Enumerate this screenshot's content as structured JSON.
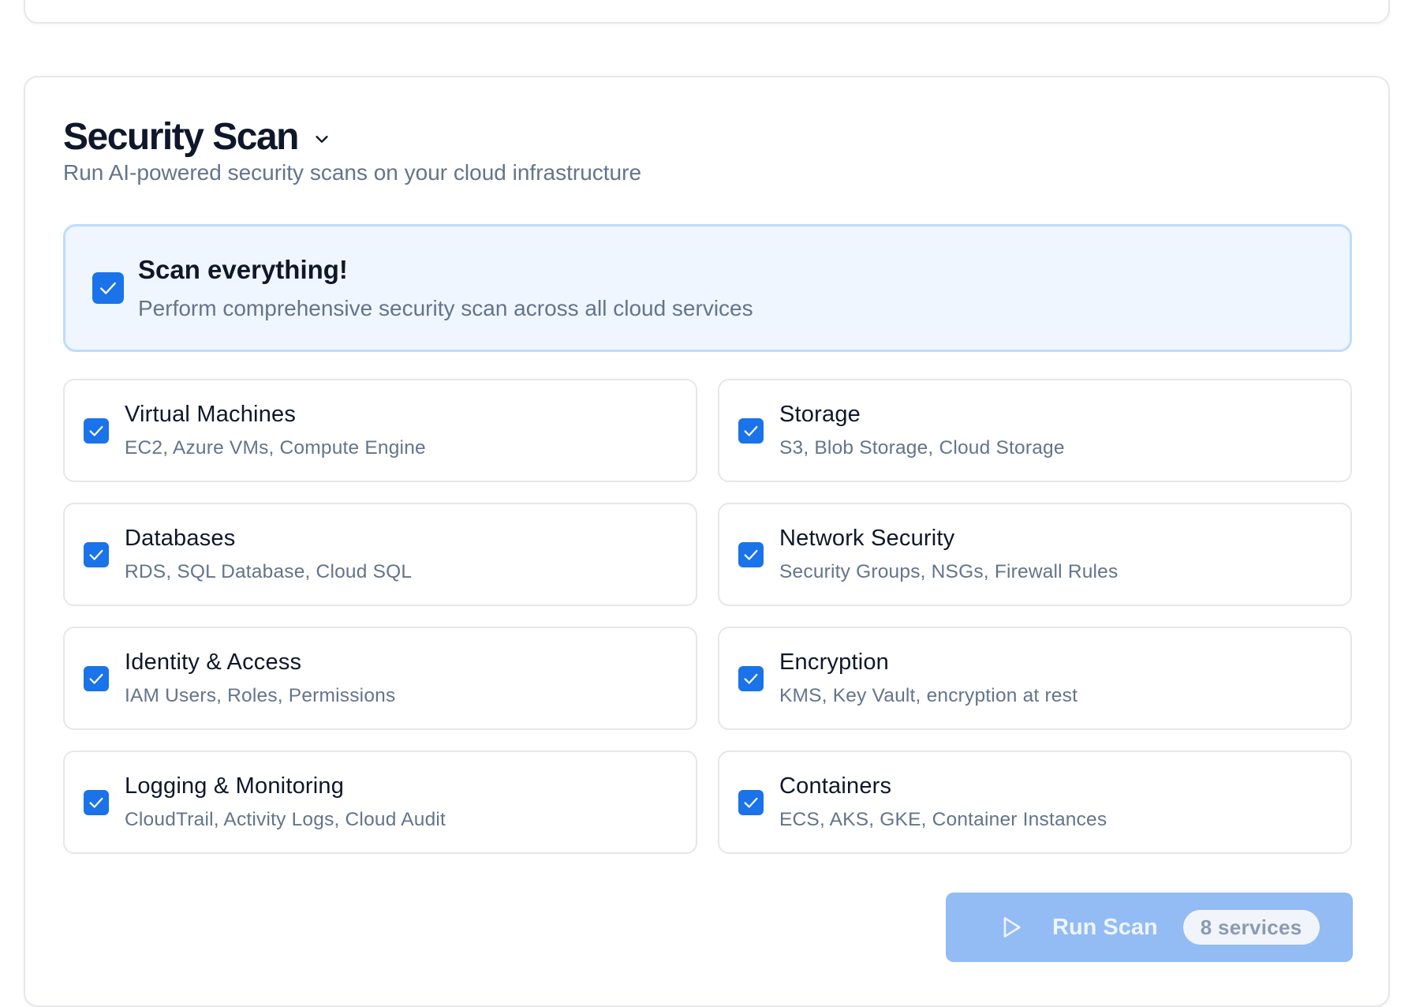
{
  "section": {
    "title": "Security Scan",
    "subtitle": "Run AI-powered security scans on your cloud infrastructure",
    "chevron_icon": "chevron-down-icon"
  },
  "scan_all": {
    "label": "Scan everything!",
    "description": "Perform comprehensive security scan across all cloud services",
    "checked": true
  },
  "services": [
    {
      "label": "Virtual Machines",
      "description": "EC2, Azure VMs, Compute Engine",
      "checked": true
    },
    {
      "label": "Storage",
      "description": "S3, Blob Storage, Cloud Storage",
      "checked": true
    },
    {
      "label": "Databases",
      "description": "RDS, SQL Database, Cloud SQL",
      "checked": true
    },
    {
      "label": "Network Security",
      "description": "Security Groups, NSGs, Firewall Rules",
      "checked": true
    },
    {
      "label": "Identity & Access",
      "description": "IAM Users, Roles, Permissions",
      "checked": true
    },
    {
      "label": "Encryption",
      "description": "KMS, Key Vault, encryption at rest",
      "checked": true
    },
    {
      "label": "Logging & Monitoring",
      "description": "CloudTrail, Activity Logs, Cloud Audit",
      "checked": true
    },
    {
      "label": "Containers",
      "description": "ECS, AKS, GKE, Container Instances",
      "checked": true
    }
  ],
  "run_button": {
    "label": "Run Scan",
    "count_badge": "8 services",
    "icon": "play-icon",
    "disabled": true
  },
  "colors": {
    "accent": "#1a73e8",
    "scan_all_bg": "#eff6ff",
    "scan_all_border": "#bfdbfe",
    "button_bg": "#93bbf4"
  }
}
